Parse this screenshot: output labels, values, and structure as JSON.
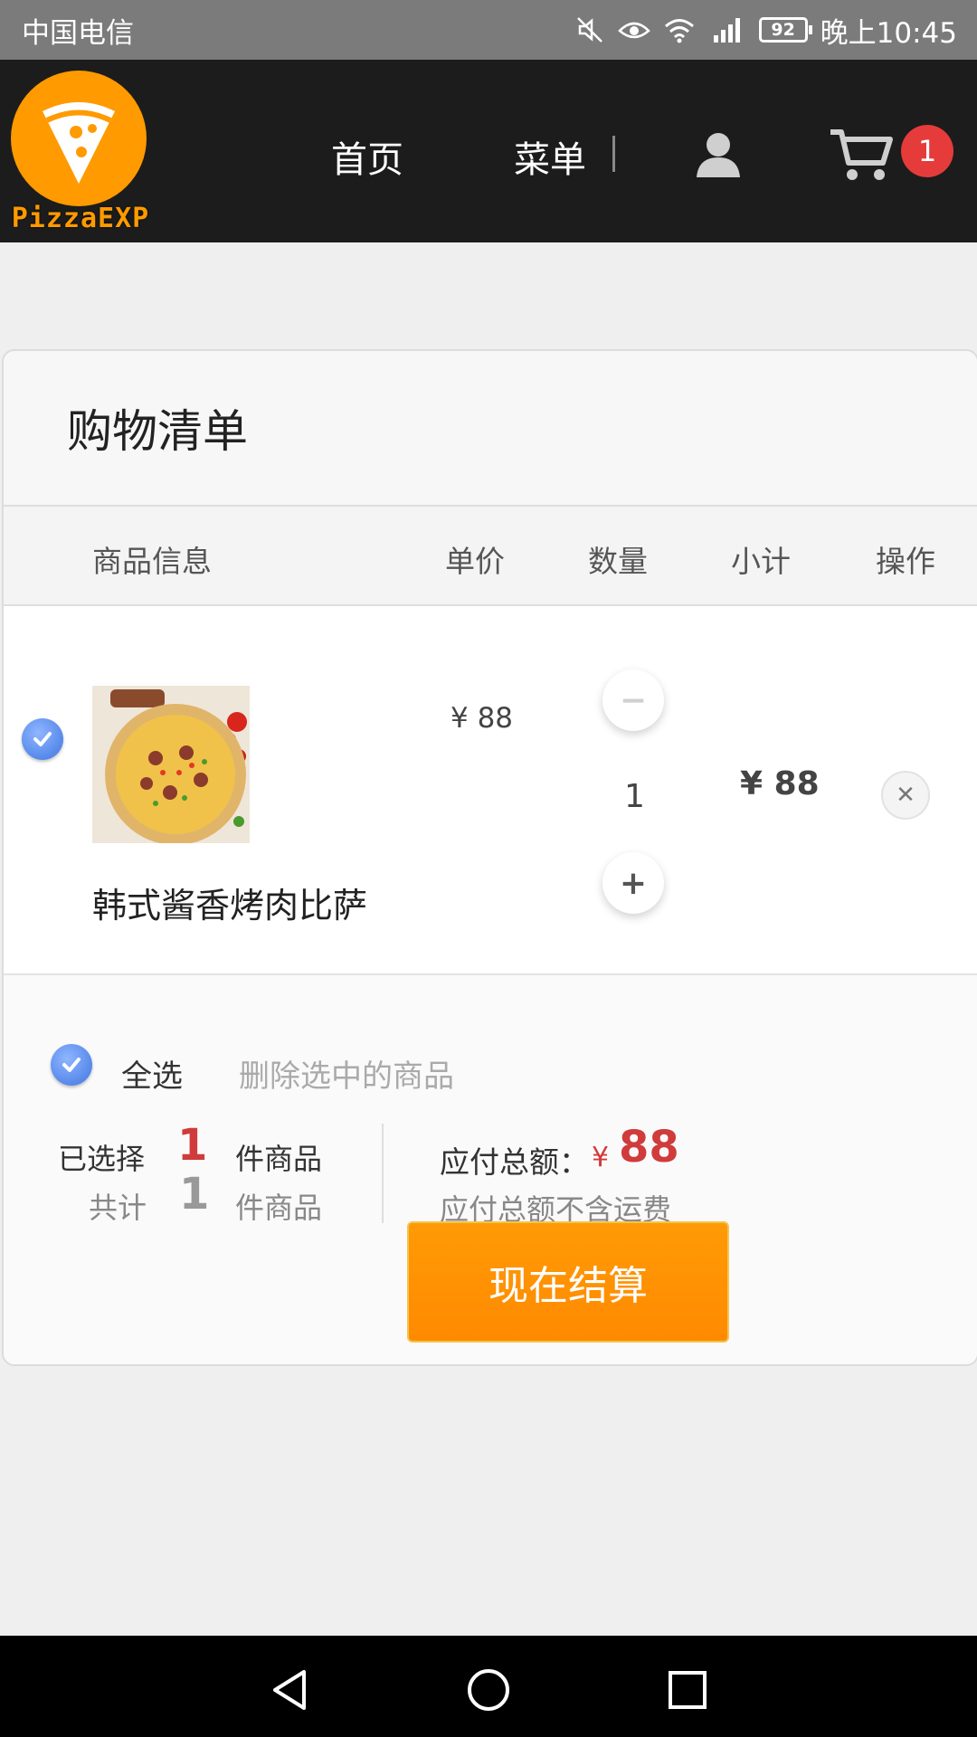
{
  "status_bar": {
    "carrier": "中国电信",
    "battery": "92",
    "time": "晚上10:45",
    "icons": [
      "mute-icon",
      "eye-icon",
      "wifi-icon",
      "4g-signal-icon",
      "battery-icon"
    ]
  },
  "header": {
    "logo_text": "PizzaEXP",
    "nav": {
      "home": "首页",
      "menu": "菜单"
    },
    "cart_count": "1",
    "colors": {
      "brand": "#ff9a00",
      "badge": "#e63b3b",
      "header_bg": "#1c1c1c"
    }
  },
  "cart": {
    "title": "购物清单",
    "columns": {
      "info": "商品信息",
      "price": "单价",
      "qty": "数量",
      "subtotal": "小计",
      "op": "操作"
    },
    "items": [
      {
        "name": "韩式酱香烤肉比萨",
        "price": "¥ 88",
        "qty": "1",
        "subtotal": "¥ 88",
        "selected": true
      }
    ]
  },
  "footer": {
    "select_all": "全选",
    "delete_selected": "删除选中的商品",
    "selected_prefix": "已选择",
    "selected_count": "1",
    "selected_suffix": "件商品",
    "total_prefix": "共计",
    "total_count": "1",
    "total_suffix": "件商品",
    "amount_label": "应付总额：",
    "amount_currency": "¥",
    "amount": "88",
    "amount_note": "应付总额不含运费",
    "checkout": "现在结算",
    "colors": {
      "accent_red": "#d03b3b",
      "checkout_orange": "#ff9a06"
    }
  }
}
